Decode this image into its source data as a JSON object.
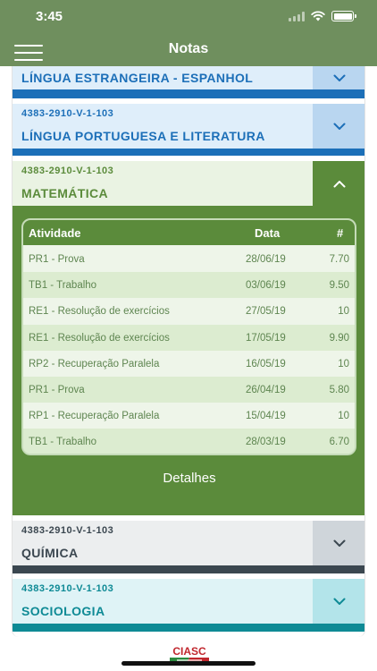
{
  "status_bar": {
    "time": "3:45"
  },
  "header": {
    "title": "Notas"
  },
  "subjects": [
    {
      "code": "",
      "name": "LÍNGUA ESTRANGEIRA - ESPANHOL",
      "expanded": false,
      "color": "#1c6fb8"
    },
    {
      "code": "4383-2910-V-1-103",
      "name": "LÍNGUA PORTUGUESA E LITERATURA",
      "expanded": false,
      "color": "#1c6fb8"
    },
    {
      "code": "4383-2910-V-1-103",
      "name": "MATEMÁTICA",
      "expanded": true,
      "color": "#5b8b3b"
    },
    {
      "code": "4383-2910-V-1-103",
      "name": "QUÍMICA",
      "expanded": false,
      "color": "#3b4750"
    },
    {
      "code": "4383-2910-V-1-103",
      "name": "SOCIOLOGIA",
      "expanded": false,
      "color": "#0e8a95"
    }
  ],
  "grades": {
    "headers": {
      "activity": "Atividade",
      "date": "Data",
      "grade": "#"
    },
    "rows": [
      {
        "activity": "PR1 - Prova",
        "date": "28/06/19",
        "grade": "7.70"
      },
      {
        "activity": "TB1 - Trabalho",
        "date": "03/06/19",
        "grade": "9.50"
      },
      {
        "activity": "RE1 - Resolução de exercícios",
        "date": "27/05/19",
        "grade": "10"
      },
      {
        "activity": "RE1 - Resolução de exercícios",
        "date": "17/05/19",
        "grade": "9.90"
      },
      {
        "activity": "RP2 - Recuperação Paralela",
        "date": "16/05/19",
        "grade": "10"
      },
      {
        "activity": "PR1 - Prova",
        "date": "26/04/19",
        "grade": "5.80"
      },
      {
        "activity": "RP1 - Recuperação Paralela",
        "date": "15/04/19",
        "grade": "10"
      },
      {
        "activity": "TB1 - Trabalho",
        "date": "28/03/19",
        "grade": "6.70"
      }
    ]
  },
  "details_label": "Detalhes",
  "footer": {
    "logo_text": "CIASC"
  }
}
